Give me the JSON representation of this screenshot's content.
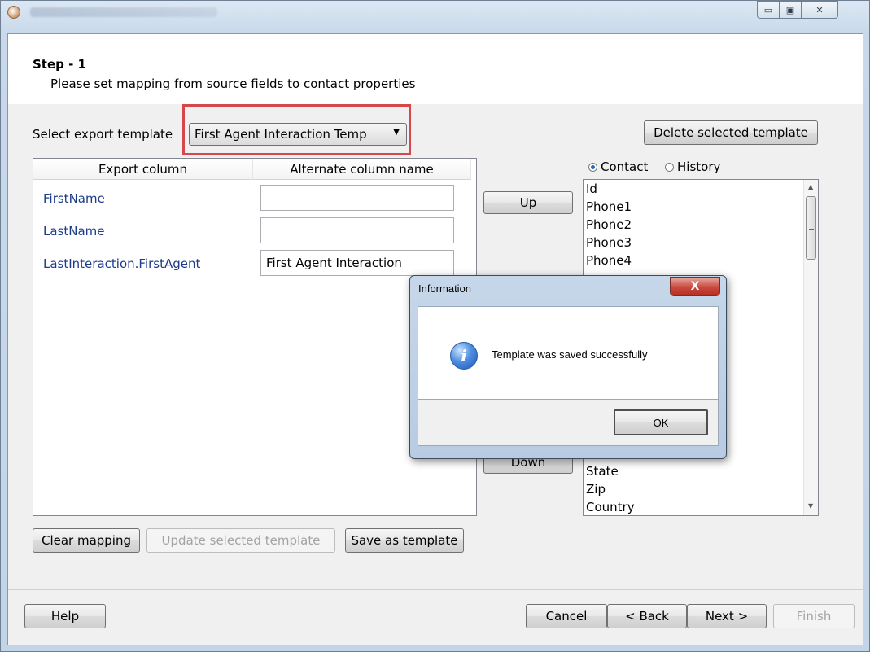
{
  "window": {
    "minimize_glyph": "▭",
    "maximize_glyph": "▣",
    "close_glyph": "✕"
  },
  "step": {
    "title": "Step - 1",
    "subtitle": "Please set mapping from source fields to contact properties"
  },
  "template": {
    "label": "Select export template",
    "selected": "First Agent Interaction Temp",
    "delete_label": "Delete selected template"
  },
  "mapping": {
    "headers": {
      "export": "Export column",
      "alternate": "Alternate column name"
    },
    "rows": [
      {
        "export": "FirstName",
        "alternate": ""
      },
      {
        "export": "LastName",
        "alternate": ""
      },
      {
        "export": "LastInteraction.FirstAgent",
        "alternate": "First Agent Interaction"
      }
    ]
  },
  "move": {
    "up_label": "Up",
    "down_label": "Down"
  },
  "source": {
    "radio_contact": "Contact",
    "radio_history": "History",
    "selected": "Contact",
    "items_top": [
      "Id",
      "Phone1",
      "Phone2",
      "Phone3",
      "Phone4"
    ],
    "items_bottom": [
      "State",
      "Zip",
      "Country"
    ]
  },
  "actions": {
    "clear_mapping": "Clear mapping",
    "update_template": "Update selected template",
    "save_template": "Save as template"
  },
  "footer": {
    "help": "Help",
    "cancel": "Cancel",
    "back": "< Back",
    "next": "Next >",
    "finish": "Finish"
  },
  "dialog": {
    "title": "Information",
    "message": "Template was saved successfully",
    "ok_label": "OK",
    "close_glyph": "X",
    "icon": "info-icon"
  },
  "colors": {
    "highlight": "#d6474b",
    "field_name": "#1e3a8a"
  }
}
